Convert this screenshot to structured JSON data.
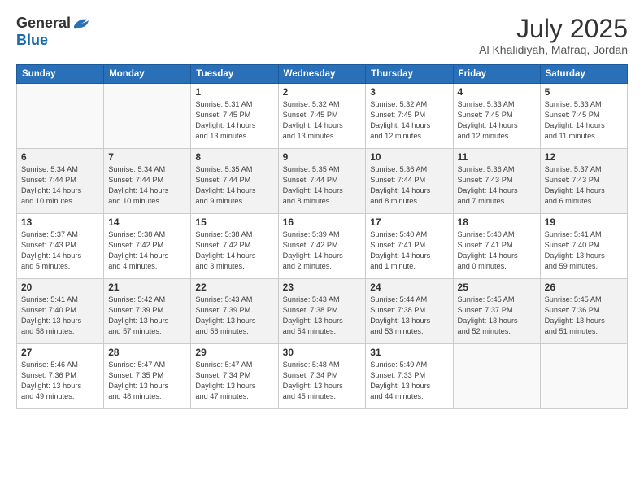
{
  "header": {
    "logo_general": "General",
    "logo_blue": "Blue",
    "month_title": "July 2025",
    "location": "Al Khalidiyah, Mafraq, Jordan"
  },
  "weekdays": [
    "Sunday",
    "Monday",
    "Tuesday",
    "Wednesday",
    "Thursday",
    "Friday",
    "Saturday"
  ],
  "weeks": [
    [
      {
        "day": "",
        "info": ""
      },
      {
        "day": "",
        "info": ""
      },
      {
        "day": "1",
        "info": "Sunrise: 5:31 AM\nSunset: 7:45 PM\nDaylight: 14 hours\nand 13 minutes."
      },
      {
        "day": "2",
        "info": "Sunrise: 5:32 AM\nSunset: 7:45 PM\nDaylight: 14 hours\nand 13 minutes."
      },
      {
        "day": "3",
        "info": "Sunrise: 5:32 AM\nSunset: 7:45 PM\nDaylight: 14 hours\nand 12 minutes."
      },
      {
        "day": "4",
        "info": "Sunrise: 5:33 AM\nSunset: 7:45 PM\nDaylight: 14 hours\nand 12 minutes."
      },
      {
        "day": "5",
        "info": "Sunrise: 5:33 AM\nSunset: 7:45 PM\nDaylight: 14 hours\nand 11 minutes."
      }
    ],
    [
      {
        "day": "6",
        "info": "Sunrise: 5:34 AM\nSunset: 7:44 PM\nDaylight: 14 hours\nand 10 minutes."
      },
      {
        "day": "7",
        "info": "Sunrise: 5:34 AM\nSunset: 7:44 PM\nDaylight: 14 hours\nand 10 minutes."
      },
      {
        "day": "8",
        "info": "Sunrise: 5:35 AM\nSunset: 7:44 PM\nDaylight: 14 hours\nand 9 minutes."
      },
      {
        "day": "9",
        "info": "Sunrise: 5:35 AM\nSunset: 7:44 PM\nDaylight: 14 hours\nand 8 minutes."
      },
      {
        "day": "10",
        "info": "Sunrise: 5:36 AM\nSunset: 7:44 PM\nDaylight: 14 hours\nand 8 minutes."
      },
      {
        "day": "11",
        "info": "Sunrise: 5:36 AM\nSunset: 7:43 PM\nDaylight: 14 hours\nand 7 minutes."
      },
      {
        "day": "12",
        "info": "Sunrise: 5:37 AM\nSunset: 7:43 PM\nDaylight: 14 hours\nand 6 minutes."
      }
    ],
    [
      {
        "day": "13",
        "info": "Sunrise: 5:37 AM\nSunset: 7:43 PM\nDaylight: 14 hours\nand 5 minutes."
      },
      {
        "day": "14",
        "info": "Sunrise: 5:38 AM\nSunset: 7:42 PM\nDaylight: 14 hours\nand 4 minutes."
      },
      {
        "day": "15",
        "info": "Sunrise: 5:38 AM\nSunset: 7:42 PM\nDaylight: 14 hours\nand 3 minutes."
      },
      {
        "day": "16",
        "info": "Sunrise: 5:39 AM\nSunset: 7:42 PM\nDaylight: 14 hours\nand 2 minutes."
      },
      {
        "day": "17",
        "info": "Sunrise: 5:40 AM\nSunset: 7:41 PM\nDaylight: 14 hours\nand 1 minute."
      },
      {
        "day": "18",
        "info": "Sunrise: 5:40 AM\nSunset: 7:41 PM\nDaylight: 14 hours\nand 0 minutes."
      },
      {
        "day": "19",
        "info": "Sunrise: 5:41 AM\nSunset: 7:40 PM\nDaylight: 13 hours\nand 59 minutes."
      }
    ],
    [
      {
        "day": "20",
        "info": "Sunrise: 5:41 AM\nSunset: 7:40 PM\nDaylight: 13 hours\nand 58 minutes."
      },
      {
        "day": "21",
        "info": "Sunrise: 5:42 AM\nSunset: 7:39 PM\nDaylight: 13 hours\nand 57 minutes."
      },
      {
        "day": "22",
        "info": "Sunrise: 5:43 AM\nSunset: 7:39 PM\nDaylight: 13 hours\nand 56 minutes."
      },
      {
        "day": "23",
        "info": "Sunrise: 5:43 AM\nSunset: 7:38 PM\nDaylight: 13 hours\nand 54 minutes."
      },
      {
        "day": "24",
        "info": "Sunrise: 5:44 AM\nSunset: 7:38 PM\nDaylight: 13 hours\nand 53 minutes."
      },
      {
        "day": "25",
        "info": "Sunrise: 5:45 AM\nSunset: 7:37 PM\nDaylight: 13 hours\nand 52 minutes."
      },
      {
        "day": "26",
        "info": "Sunrise: 5:45 AM\nSunset: 7:36 PM\nDaylight: 13 hours\nand 51 minutes."
      }
    ],
    [
      {
        "day": "27",
        "info": "Sunrise: 5:46 AM\nSunset: 7:36 PM\nDaylight: 13 hours\nand 49 minutes."
      },
      {
        "day": "28",
        "info": "Sunrise: 5:47 AM\nSunset: 7:35 PM\nDaylight: 13 hours\nand 48 minutes."
      },
      {
        "day": "29",
        "info": "Sunrise: 5:47 AM\nSunset: 7:34 PM\nDaylight: 13 hours\nand 47 minutes."
      },
      {
        "day": "30",
        "info": "Sunrise: 5:48 AM\nSunset: 7:34 PM\nDaylight: 13 hours\nand 45 minutes."
      },
      {
        "day": "31",
        "info": "Sunrise: 5:49 AM\nSunset: 7:33 PM\nDaylight: 13 hours\nand 44 minutes."
      },
      {
        "day": "",
        "info": ""
      },
      {
        "day": "",
        "info": ""
      }
    ]
  ]
}
